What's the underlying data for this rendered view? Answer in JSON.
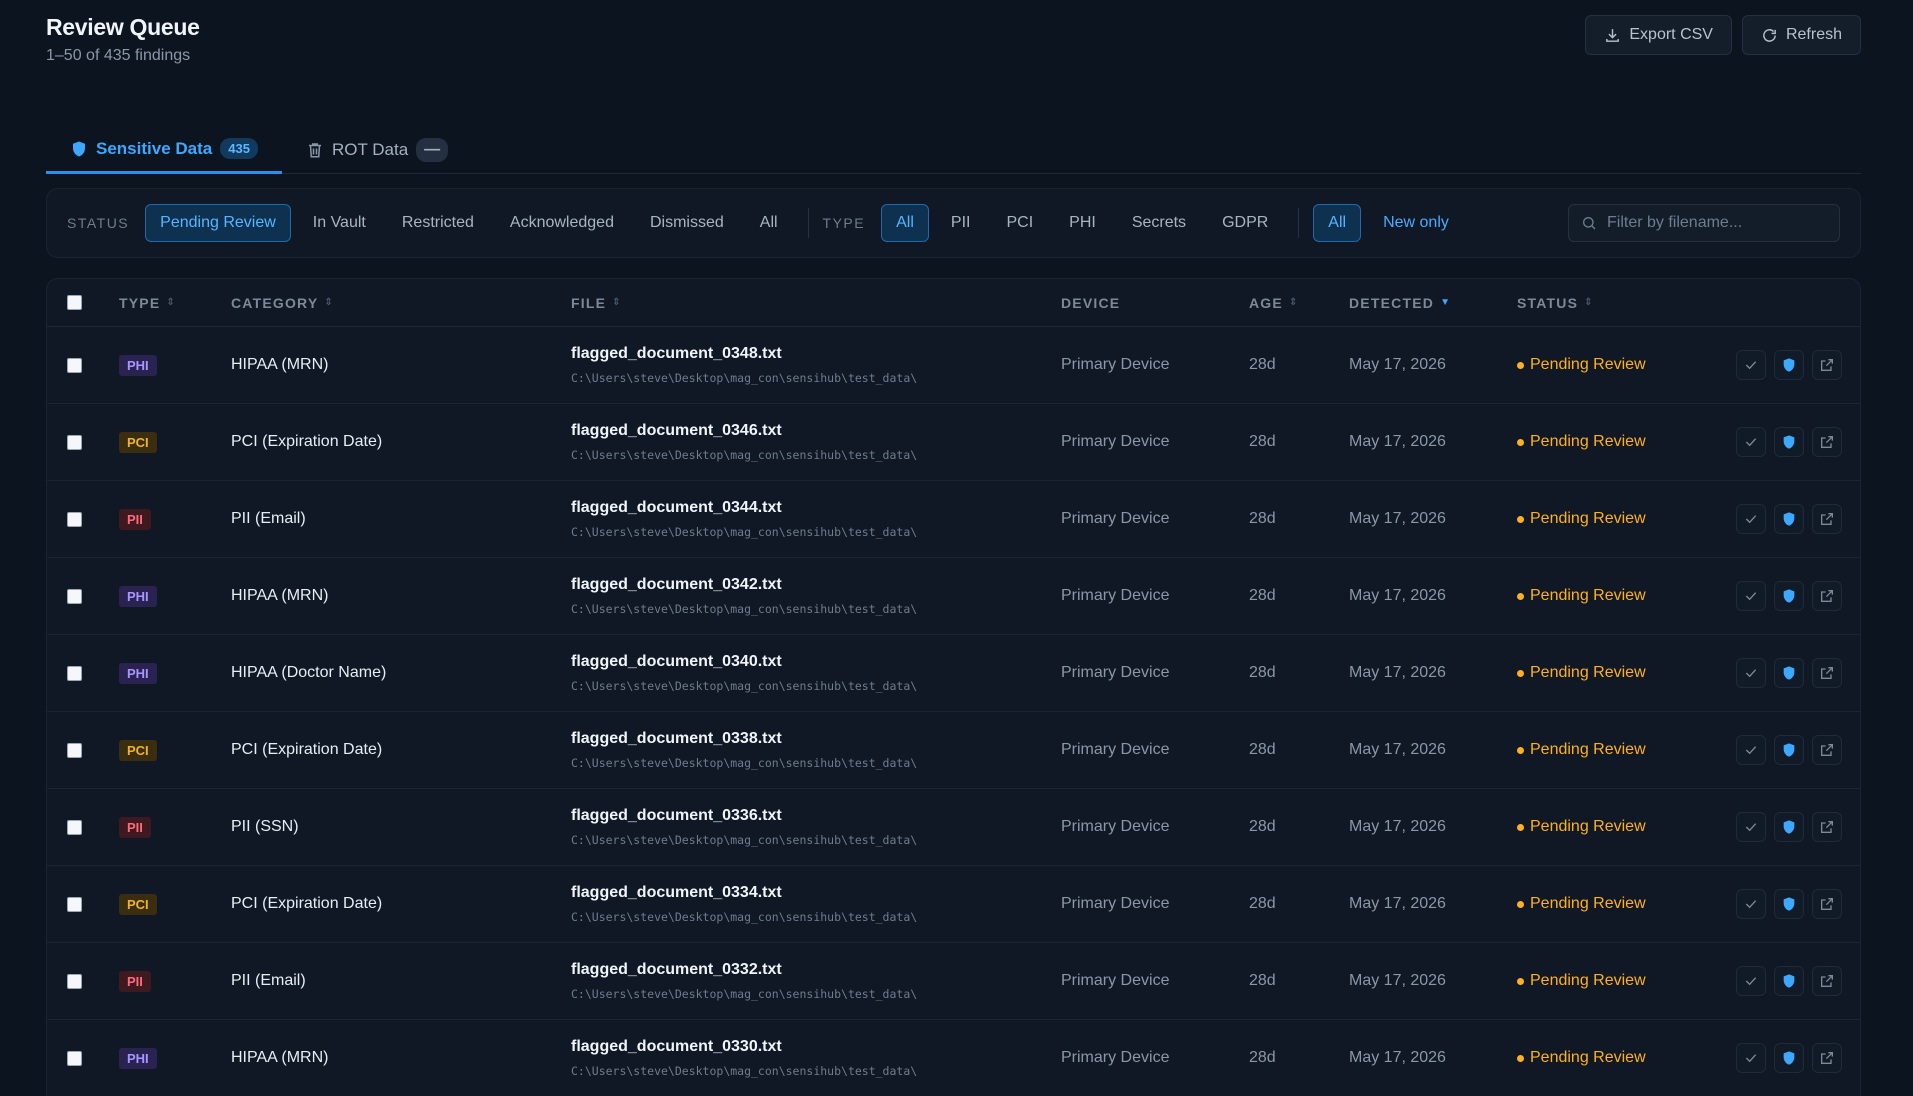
{
  "header": {
    "title": "Review Queue",
    "subtitle": "1–50 of 435 findings"
  },
  "actions": {
    "export_label": "Export CSV",
    "refresh_label": "Refresh"
  },
  "tabs": [
    {
      "label": "Sensitive Data",
      "count": "435",
      "icon": "shield-icon"
    },
    {
      "label": "ROT Data",
      "count": "—",
      "icon": "trash-icon"
    }
  ],
  "filters": {
    "status_label": "STATUS",
    "status_options": [
      "Pending Review",
      "In Vault",
      "Restricted",
      "Acknowledged",
      "Dismissed",
      "All"
    ],
    "type_label": "TYPE",
    "type_options": [
      "All",
      "PII",
      "PCI",
      "PHI",
      "Secrets",
      "GDPR"
    ],
    "scope_all": "All",
    "scope_new": "New only",
    "search_placeholder": "Filter by filename..."
  },
  "columns": {
    "type": "TYPE",
    "category": "CATEGORY",
    "file": "FILE",
    "device": "DEVICE",
    "age": "AGE",
    "detected": "DETECTED",
    "status": "STATUS"
  },
  "colors": {
    "accent": "#3ea8ff",
    "pending": "#ffb020",
    "phi": "#a895ff",
    "pci": "#f0b429",
    "pii": "#ff6b7a"
  },
  "rows": [
    {
      "type": "PHI",
      "category": "HIPAA (MRN)",
      "file": "flagged_document_0348.txt",
      "path": "C:\\Users\\steve\\Desktop\\mag_con\\sensihub\\test_data\\",
      "device": "Primary Device",
      "age": "28d",
      "detected": "May 17, 2026",
      "status": "Pending Review"
    },
    {
      "type": "PCI",
      "category": "PCI (Expiration Date)",
      "file": "flagged_document_0346.txt",
      "path": "C:\\Users\\steve\\Desktop\\mag_con\\sensihub\\test_data\\",
      "device": "Primary Device",
      "age": "28d",
      "detected": "May 17, 2026",
      "status": "Pending Review"
    },
    {
      "type": "PII",
      "category": "PII (Email)",
      "file": "flagged_document_0344.txt",
      "path": "C:\\Users\\steve\\Desktop\\mag_con\\sensihub\\test_data\\",
      "device": "Primary Device",
      "age": "28d",
      "detected": "May 17, 2026",
      "status": "Pending Review"
    },
    {
      "type": "PHI",
      "category": "HIPAA (MRN)",
      "file": "flagged_document_0342.txt",
      "path": "C:\\Users\\steve\\Desktop\\mag_con\\sensihub\\test_data\\",
      "device": "Primary Device",
      "age": "28d",
      "detected": "May 17, 2026",
      "status": "Pending Review"
    },
    {
      "type": "PHI",
      "category": "HIPAA (Doctor Name)",
      "file": "flagged_document_0340.txt",
      "path": "C:\\Users\\steve\\Desktop\\mag_con\\sensihub\\test_data\\",
      "device": "Primary Device",
      "age": "28d",
      "detected": "May 17, 2026",
      "status": "Pending Review"
    },
    {
      "type": "PCI",
      "category": "PCI (Expiration Date)",
      "file": "flagged_document_0338.txt",
      "path": "C:\\Users\\steve\\Desktop\\mag_con\\sensihub\\test_data\\",
      "device": "Primary Device",
      "age": "28d",
      "detected": "May 17, 2026",
      "status": "Pending Review"
    },
    {
      "type": "PII",
      "category": "PII (SSN)",
      "file": "flagged_document_0336.txt",
      "path": "C:\\Users\\steve\\Desktop\\mag_con\\sensihub\\test_data\\",
      "device": "Primary Device",
      "age": "28d",
      "detected": "May 17, 2026",
      "status": "Pending Review"
    },
    {
      "type": "PCI",
      "category": "PCI (Expiration Date)",
      "file": "flagged_document_0334.txt",
      "path": "C:\\Users\\steve\\Desktop\\mag_con\\sensihub\\test_data\\",
      "device": "Primary Device",
      "age": "28d",
      "detected": "May 17, 2026",
      "status": "Pending Review"
    },
    {
      "type": "PII",
      "category": "PII (Email)",
      "file": "flagged_document_0332.txt",
      "path": "C:\\Users\\steve\\Desktop\\mag_con\\sensihub\\test_data\\",
      "device": "Primary Device",
      "age": "28d",
      "detected": "May 17, 2026",
      "status": "Pending Review"
    },
    {
      "type": "PHI",
      "category": "HIPAA (MRN)",
      "file": "flagged_document_0330.txt",
      "path": "C:\\Users\\steve\\Desktop\\mag_con\\sensihub\\test_data\\",
      "device": "Primary Device",
      "age": "28d",
      "detected": "May 17, 2026",
      "status": "Pending Review"
    }
  ]
}
